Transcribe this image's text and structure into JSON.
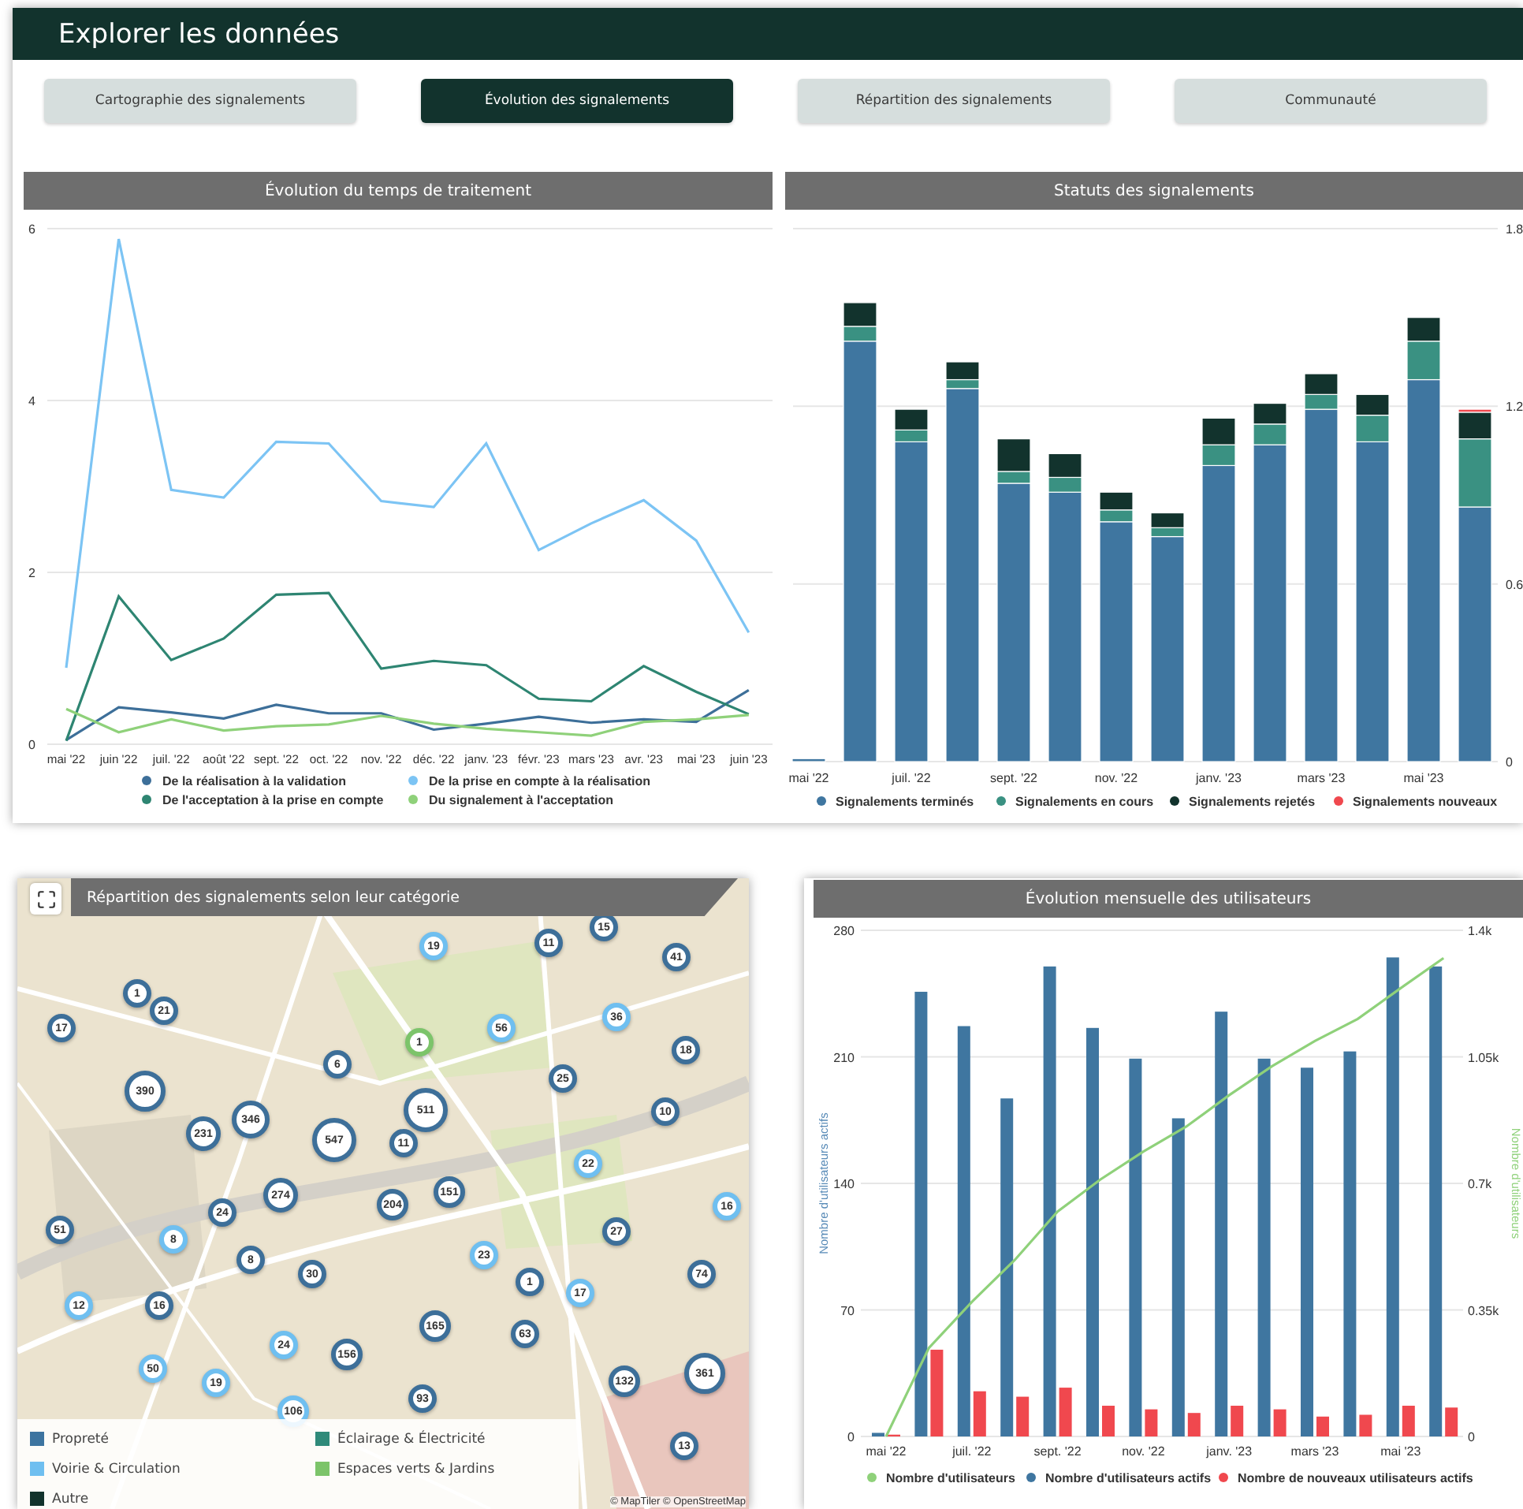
{
  "header": {
    "title": "Explorer les données"
  },
  "tabs": [
    {
      "label": "Cartographie des signalements",
      "selected": false
    },
    {
      "label": "Évolution des signalements",
      "selected": true
    },
    {
      "label": "Répartition des signalements",
      "selected": false
    },
    {
      "label": "Communauté",
      "selected": false
    }
  ],
  "processing_time_chart": {
    "title": "Évolution du temps de traitement",
    "chart_data": {
      "type": "line",
      "legend": "bottom",
      "grid": true,
      "categories": [
        "mai '22",
        "juin '22",
        "juil. '22",
        "août '22",
        "sept. '22",
        "oct. '22",
        "nov. '22",
        "déc. '22",
        "janv. '23",
        "févr. '23",
        "mars '23",
        "avr. '23",
        "mai '23",
        "juin '23"
      ],
      "ylim": [
        0,
        6
      ],
      "yticks": [
        0,
        2,
        4,
        6
      ],
      "series": [
        {
          "name": "De la réalisation à la validation",
          "color": "#3d6f99",
          "values": [
            0.05,
            0.43,
            0.37,
            0.3,
            0.46,
            0.36,
            0.36,
            0.17,
            0.24,
            0.32,
            0.25,
            0.29,
            0.26,
            0.63
          ]
        },
        {
          "name": "De la prise en compte à la réalisation",
          "color": "#7cc4f4",
          "values": [
            0.89,
            5.88,
            2.96,
            2.87,
            3.52,
            3.5,
            2.83,
            2.76,
            3.5,
            2.26,
            2.57,
            2.84,
            2.37,
            1.3
          ]
        },
        {
          "name": "De l'acceptation à la prise en compte",
          "color": "#2e8572",
          "values": [
            0.04,
            1.72,
            0.98,
            1.23,
            1.74,
            1.76,
            0.88,
            0.97,
            0.92,
            0.53,
            0.5,
            0.91,
            0.61,
            0.35
          ]
        },
        {
          "name": "Du signalement à l'acceptation",
          "color": "#8fd17a",
          "values": [
            0.41,
            0.14,
            0.29,
            0.16,
            0.21,
            0.23,
            0.33,
            0.24,
            0.18,
            0.14,
            0.1,
            0.26,
            0.29,
            0.34
          ]
        }
      ]
    }
  },
  "status_chart": {
    "title": "Statuts des signalements",
    "chart_data": {
      "type": "bar",
      "stacked": true,
      "legend": "bottom",
      "grid": true,
      "categories": [
        "mai '22",
        null,
        "juil. '22",
        null,
        "sept. '22",
        null,
        "nov. '22",
        null,
        "janv. '23",
        null,
        "mars '23",
        null,
        "mai '23",
        null
      ],
      "ylim": [
        0,
        1.8
      ],
      "yticks": [
        0,
        0.6,
        1.2,
        1.8
      ],
      "series": [
        {
          "name": "Signalements terminés",
          "color": "#3f76a0",
          "values": [
            0.01,
            1.42,
            1.08,
            1.26,
            0.94,
            0.91,
            0.81,
            0.76,
            1.0,
            1.07,
            1.19,
            1.08,
            1.29,
            0.86
          ]
        },
        {
          "name": "Signalements en cours",
          "color": "#3a9182",
          "values": [
            0,
            0.05,
            0.04,
            0.03,
            0.04,
            0.05,
            0.04,
            0.03,
            0.07,
            0.07,
            0.05,
            0.09,
            0.13,
            0.23
          ]
        },
        {
          "name": "Signalements rejetés",
          "color": "#12332d",
          "values": [
            0,
            0.08,
            0.07,
            0.06,
            0.11,
            0.08,
            0.06,
            0.05,
            0.09,
            0.07,
            0.07,
            0.07,
            0.08,
            0.09
          ]
        },
        {
          "name": "Signalements nouveaux",
          "color": "#f0484e",
          "values": [
            0,
            0,
            0,
            0,
            0,
            0,
            0,
            0,
            0,
            0,
            0,
            0,
            0,
            0.01
          ]
        }
      ]
    }
  },
  "map": {
    "title": "Répartition des signalements selon leur catégorie",
    "markers": [
      {
        "label": "15",
        "color": "#3d6f99"
      },
      {
        "label": "19",
        "color": "#6fbff0"
      },
      {
        "label": "11",
        "color": "#3d6f99"
      },
      {
        "label": "41",
        "color": "#3d6f99"
      },
      {
        "label": "1",
        "color": "#3d6f99"
      },
      {
        "label": "21",
        "color": "#3d6f99"
      },
      {
        "label": "17",
        "color": "#3d6f99"
      },
      {
        "label": "56",
        "color": "#6fbff0"
      },
      {
        "label": "36",
        "color": "#6fbff0"
      },
      {
        "label": "1",
        "color": "#7cc46a"
      },
      {
        "label": "6",
        "color": "#3d6f99"
      },
      {
        "label": "18",
        "color": "#3d6f99"
      },
      {
        "label": "25",
        "color": "#3d6f99"
      },
      {
        "label": "390",
        "color": "#3d6f99"
      },
      {
        "label": "346",
        "color": "#3d6f99"
      },
      {
        "label": "231",
        "color": "#3d6f99"
      },
      {
        "label": "547",
        "color": "#3d6f99"
      },
      {
        "label": "511",
        "color": "#3d6f99"
      },
      {
        "label": "11",
        "color": "#3d6f99"
      },
      {
        "label": "10",
        "color": "#3d6f99"
      },
      {
        "label": "22",
        "color": "#6fbff0"
      },
      {
        "label": "274",
        "color": "#3d6f99"
      },
      {
        "label": "204",
        "color": "#3d6f99"
      },
      {
        "label": "151",
        "color": "#3d6f99"
      },
      {
        "label": "24",
        "color": "#3d6f99"
      },
      {
        "label": "51",
        "color": "#3d6f99"
      },
      {
        "label": "16",
        "color": "#6fbff0"
      },
      {
        "label": "27",
        "color": "#3d6f99"
      },
      {
        "label": "8",
        "color": "#6fbff0"
      },
      {
        "label": "8",
        "color": "#3d6f99"
      },
      {
        "label": "30",
        "color": "#3d6f99"
      },
      {
        "label": "23",
        "color": "#6fbff0"
      },
      {
        "label": "1",
        "color": "#3d6f99"
      },
      {
        "label": "17",
        "color": "#6fbff0"
      },
      {
        "label": "74",
        "color": "#3d6f99"
      },
      {
        "label": "12",
        "color": "#6fbff0"
      },
      {
        "label": "16",
        "color": "#3d6f99"
      },
      {
        "label": "165",
        "color": "#3d6f99"
      },
      {
        "label": "63",
        "color": "#3d6f99"
      },
      {
        "label": "24",
        "color": "#6fbff0"
      },
      {
        "label": "156",
        "color": "#3d6f99"
      },
      {
        "label": "50",
        "color": "#6fbff0"
      },
      {
        "label": "19",
        "color": "#6fbff0"
      },
      {
        "label": "132",
        "color": "#3d6f99"
      },
      {
        "label": "361",
        "color": "#3d6f99"
      },
      {
        "label": "106",
        "color": "#6fbff0"
      },
      {
        "label": "93",
        "color": "#3d6f99"
      },
      {
        "label": "13",
        "color": "#3d6f99"
      }
    ],
    "legend": [
      {
        "label": "Propreté",
        "color": "#3d74a0"
      },
      {
        "label": "Éclairage & Électricité",
        "color": "#2f8a7a"
      },
      {
        "label": "Voirie & Circulation",
        "color": "#6fbff0"
      },
      {
        "label": "Espaces verts & Jardins",
        "color": "#7cc46a"
      },
      {
        "label": "Autre",
        "color": "#12332d"
      }
    ],
    "attribution": "© MapTiler © OpenStreetMap"
  },
  "users_chart": {
    "title": "Évolution mensuelle des utilisateurs",
    "chart_data": {
      "type": "bar",
      "legend": "bottom",
      "grid": true,
      "categories": [
        "mai '22",
        null,
        "juil. '22",
        null,
        "sept. '22",
        null,
        "nov. '22",
        null,
        "janv. '23",
        null,
        "mars '23",
        null,
        "mai '23",
        null
      ],
      "ylabel": "Nombre d'utilisateurs actifs",
      "y2label": "Nombre d'utilisateurs",
      "ylim": [
        0,
        280
      ],
      "yticks": [
        0,
        70,
        140,
        210,
        280
      ],
      "y2lim": [
        0,
        1400
      ],
      "y2ticks": [
        {
          "value": 0,
          "label": "0"
        },
        {
          "value": 350,
          "label": "0.35k"
        },
        {
          "value": 700,
          "label": "0.7k"
        },
        {
          "value": 1050,
          "label": "1.05k"
        },
        {
          "value": 1400,
          "label": "1.4k"
        }
      ],
      "series": [
        {
          "name": "Nombre d'utilisateurs",
          "color": "#8fd17a",
          "type": "line",
          "axis": "y2",
          "values": [
            0,
            245,
            372,
            488,
            622,
            711,
            788,
            857,
            944,
            1024,
            1094,
            1155,
            1240,
            1323
          ]
        },
        {
          "name": "Nombre d'utilisateurs actifs",
          "color": "#3f76a0",
          "type": "bar",
          "values": [
            2,
            246,
            227,
            187,
            260,
            226,
            209,
            176,
            235,
            209,
            204,
            213,
            265,
            260
          ]
        },
        {
          "name": "Nombre de nouveaux utilisateurs actifs",
          "color": "#f0484e",
          "type": "bar",
          "values": [
            1,
            48,
            25,
            22,
            27,
            17,
            15,
            13,
            17,
            15,
            11,
            12,
            17,
            16
          ]
        }
      ]
    }
  }
}
